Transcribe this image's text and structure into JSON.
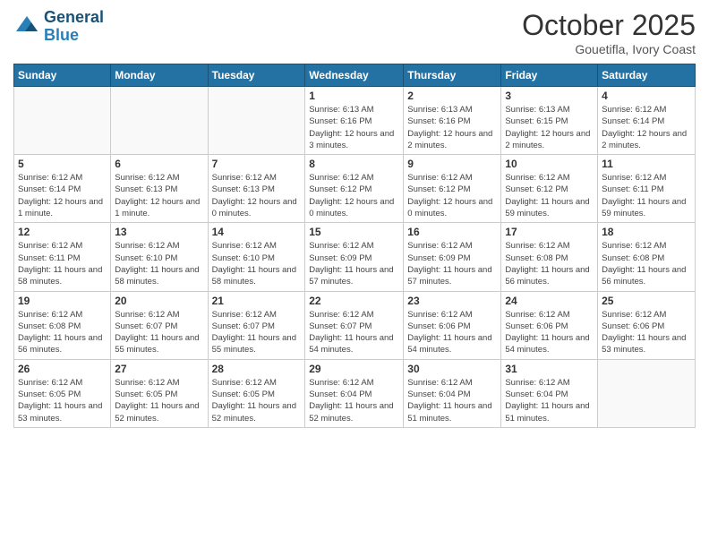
{
  "header": {
    "logo_line1": "General",
    "logo_line2": "Blue",
    "month": "October 2025",
    "location": "Gouetifla, Ivory Coast"
  },
  "weekdays": [
    "Sunday",
    "Monday",
    "Tuesday",
    "Wednesday",
    "Thursday",
    "Friday",
    "Saturday"
  ],
  "weeks": [
    [
      {
        "day": "",
        "info": ""
      },
      {
        "day": "",
        "info": ""
      },
      {
        "day": "",
        "info": ""
      },
      {
        "day": "1",
        "info": "Sunrise: 6:13 AM\nSunset: 6:16 PM\nDaylight: 12 hours and 3 minutes."
      },
      {
        "day": "2",
        "info": "Sunrise: 6:13 AM\nSunset: 6:16 PM\nDaylight: 12 hours and 2 minutes."
      },
      {
        "day": "3",
        "info": "Sunrise: 6:13 AM\nSunset: 6:15 PM\nDaylight: 12 hours and 2 minutes."
      },
      {
        "day": "4",
        "info": "Sunrise: 6:12 AM\nSunset: 6:14 PM\nDaylight: 12 hours and 2 minutes."
      }
    ],
    [
      {
        "day": "5",
        "info": "Sunrise: 6:12 AM\nSunset: 6:14 PM\nDaylight: 12 hours and 1 minute."
      },
      {
        "day": "6",
        "info": "Sunrise: 6:12 AM\nSunset: 6:13 PM\nDaylight: 12 hours and 1 minute."
      },
      {
        "day": "7",
        "info": "Sunrise: 6:12 AM\nSunset: 6:13 PM\nDaylight: 12 hours and 0 minutes."
      },
      {
        "day": "8",
        "info": "Sunrise: 6:12 AM\nSunset: 6:12 PM\nDaylight: 12 hours and 0 minutes."
      },
      {
        "day": "9",
        "info": "Sunrise: 6:12 AM\nSunset: 6:12 PM\nDaylight: 12 hours and 0 minutes."
      },
      {
        "day": "10",
        "info": "Sunrise: 6:12 AM\nSunset: 6:12 PM\nDaylight: 11 hours and 59 minutes."
      },
      {
        "day": "11",
        "info": "Sunrise: 6:12 AM\nSunset: 6:11 PM\nDaylight: 11 hours and 59 minutes."
      }
    ],
    [
      {
        "day": "12",
        "info": "Sunrise: 6:12 AM\nSunset: 6:11 PM\nDaylight: 11 hours and 58 minutes."
      },
      {
        "day": "13",
        "info": "Sunrise: 6:12 AM\nSunset: 6:10 PM\nDaylight: 11 hours and 58 minutes."
      },
      {
        "day": "14",
        "info": "Sunrise: 6:12 AM\nSunset: 6:10 PM\nDaylight: 11 hours and 58 minutes."
      },
      {
        "day": "15",
        "info": "Sunrise: 6:12 AM\nSunset: 6:09 PM\nDaylight: 11 hours and 57 minutes."
      },
      {
        "day": "16",
        "info": "Sunrise: 6:12 AM\nSunset: 6:09 PM\nDaylight: 11 hours and 57 minutes."
      },
      {
        "day": "17",
        "info": "Sunrise: 6:12 AM\nSunset: 6:08 PM\nDaylight: 11 hours and 56 minutes."
      },
      {
        "day": "18",
        "info": "Sunrise: 6:12 AM\nSunset: 6:08 PM\nDaylight: 11 hours and 56 minutes."
      }
    ],
    [
      {
        "day": "19",
        "info": "Sunrise: 6:12 AM\nSunset: 6:08 PM\nDaylight: 11 hours and 56 minutes."
      },
      {
        "day": "20",
        "info": "Sunrise: 6:12 AM\nSunset: 6:07 PM\nDaylight: 11 hours and 55 minutes."
      },
      {
        "day": "21",
        "info": "Sunrise: 6:12 AM\nSunset: 6:07 PM\nDaylight: 11 hours and 55 minutes."
      },
      {
        "day": "22",
        "info": "Sunrise: 6:12 AM\nSunset: 6:07 PM\nDaylight: 11 hours and 54 minutes."
      },
      {
        "day": "23",
        "info": "Sunrise: 6:12 AM\nSunset: 6:06 PM\nDaylight: 11 hours and 54 minutes."
      },
      {
        "day": "24",
        "info": "Sunrise: 6:12 AM\nSunset: 6:06 PM\nDaylight: 11 hours and 54 minutes."
      },
      {
        "day": "25",
        "info": "Sunrise: 6:12 AM\nSunset: 6:06 PM\nDaylight: 11 hours and 53 minutes."
      }
    ],
    [
      {
        "day": "26",
        "info": "Sunrise: 6:12 AM\nSunset: 6:05 PM\nDaylight: 11 hours and 53 minutes."
      },
      {
        "day": "27",
        "info": "Sunrise: 6:12 AM\nSunset: 6:05 PM\nDaylight: 11 hours and 52 minutes."
      },
      {
        "day": "28",
        "info": "Sunrise: 6:12 AM\nSunset: 6:05 PM\nDaylight: 11 hours and 52 minutes."
      },
      {
        "day": "29",
        "info": "Sunrise: 6:12 AM\nSunset: 6:04 PM\nDaylight: 11 hours and 52 minutes."
      },
      {
        "day": "30",
        "info": "Sunrise: 6:12 AM\nSunset: 6:04 PM\nDaylight: 11 hours and 51 minutes."
      },
      {
        "day": "31",
        "info": "Sunrise: 6:12 AM\nSunset: 6:04 PM\nDaylight: 11 hours and 51 minutes."
      },
      {
        "day": "",
        "info": ""
      }
    ]
  ]
}
